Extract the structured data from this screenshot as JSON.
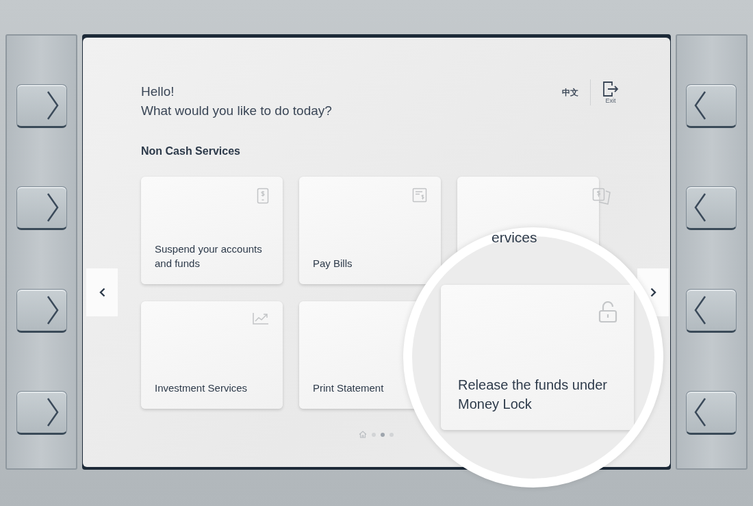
{
  "language_button": "中文",
  "exit_button": "Exit",
  "greeting": "Hello!",
  "question": "What would you like to do today?",
  "section_title": "Non Cash Services",
  "cards": [
    {
      "label": "Suspend your accounts and funds",
      "kind": "phone"
    },
    {
      "label": "Pay Bills",
      "kind": "bill"
    },
    {
      "label": "ervices",
      "kind": "cards"
    },
    {
      "label": "Investment Services",
      "kind": "chart"
    },
    {
      "label": "Print Statement",
      "kind": "plain"
    }
  ],
  "magnified_card": {
    "label": "Release the funds under Money Lock",
    "kind": "lock"
  },
  "pager": [
    {
      "kind": "home",
      "selected": false
    },
    {
      "kind": "dot",
      "selected": false
    },
    {
      "kind": "dot",
      "selected": true
    },
    {
      "kind": "dot",
      "selected": false
    }
  ]
}
